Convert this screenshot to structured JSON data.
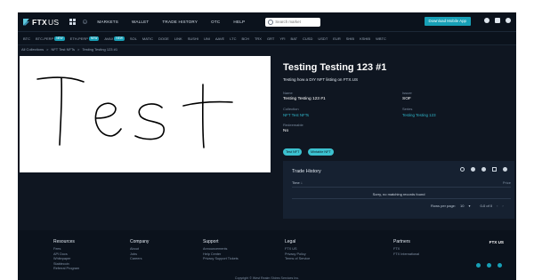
{
  "header": {
    "brand": "FTX",
    "brand_suffix": "US",
    "nav": [
      "MARKETS",
      "WALLET",
      "TRADE HISTORY",
      "OTC",
      "HELP"
    ],
    "search_placeholder": "Search market",
    "download_label": "Download Mobile App"
  },
  "ticker": [
    {
      "label": "BTC"
    },
    {
      "label": "BTC-PERP",
      "badge": "NEW"
    },
    {
      "label": "ETH-PERP",
      "badge": "NEW"
    },
    {
      "label": "AVAX",
      "badge": "NEW"
    },
    {
      "label": "SOL"
    },
    {
      "label": "MATIC"
    },
    {
      "label": "DOGE"
    },
    {
      "label": "LINK"
    },
    {
      "label": "SUSHI"
    },
    {
      "label": "UNI"
    },
    {
      "label": "AAVE"
    },
    {
      "label": "LTC"
    },
    {
      "label": "BCH"
    },
    {
      "label": "TRX"
    },
    {
      "label": "GRT"
    },
    {
      "label": "YFI"
    },
    {
      "label": "BAT"
    },
    {
      "label": "CUSD"
    },
    {
      "label": "USDT"
    },
    {
      "label": "EUR"
    },
    {
      "label": "SHIB"
    },
    {
      "label": "KSHIB"
    },
    {
      "label": "WBTC"
    }
  ],
  "breadcrumb": [
    "All Collections",
    ">",
    "NFT Test NFTs",
    ">",
    "Testing Testing 123 #1"
  ],
  "artwork": {
    "text": "Test"
  },
  "nft": {
    "title": "Testing Testing 123 #1",
    "subtitle": "Testing how a DIY NFT listing on FTX.US",
    "name_label": "Name",
    "name_value": "Testing Testing 123 #1",
    "issuer_label": "Issuer",
    "issuer_value": "SOF",
    "collection_label": "Collection",
    "collection_value": "NFT Test NFTs",
    "series_label": "Series",
    "series_value": "Testing Testing 123",
    "redeemable_label": "Redeemable",
    "redeemable_value": "No",
    "tags": [
      "Test NFT",
      "Mintable NFT"
    ]
  },
  "trade_history": {
    "title": "Trade History",
    "column": "Time ↓",
    "column_right": "Price",
    "empty": "Sorry, no matching records found",
    "rows_per_page_label": "Rows per page:",
    "rows_per_page": "10",
    "range": "0-0 of 0"
  },
  "footer": {
    "columns": [
      {
        "title": "Resources",
        "links": [
          "Fees",
          "API Docs",
          "Whitepaper",
          "Stablecoin",
          "Referral Program"
        ]
      },
      {
        "title": "Company",
        "links": [
          "About",
          "Jobs",
          "Careers"
        ]
      },
      {
        "title": "Support",
        "links": [
          "Announcements",
          "Help Center",
          "Privacy Support Tickets"
        ]
      },
      {
        "title": "Legal",
        "links": [
          "FTX US",
          "Privacy Policy",
          "Terms of Service"
        ]
      },
      {
        "title": "Partners",
        "links": [
          "FTX",
          "FTX International"
        ]
      }
    ],
    "logo": "FTX US",
    "copyright": "Copyright © West Realm Shires Services Inc."
  }
}
